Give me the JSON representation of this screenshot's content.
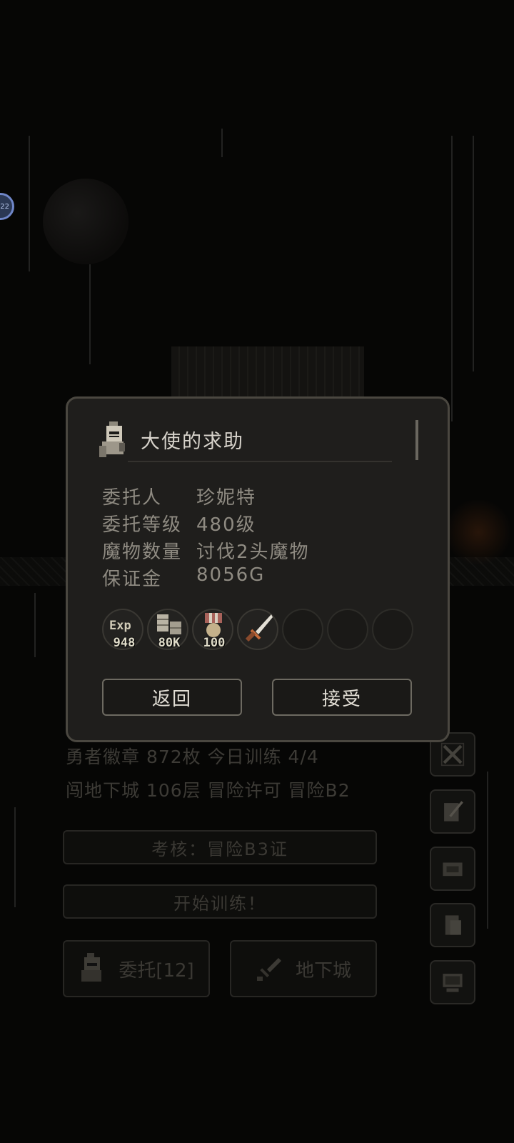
{
  "top_badge": "22",
  "dialog": {
    "title": "大使的求助",
    "details": [
      {
        "label": "委托人",
        "value": "珍妮特"
      },
      {
        "label": "委托等级",
        "value": "480级"
      },
      {
        "label": "魔物数量",
        "value": "讨伐2头魔物"
      },
      {
        "label": "保证金",
        "value": "8056G"
      }
    ],
    "rewards": [
      {
        "icon": "exp-icon",
        "icon_text": "Exp",
        "count": "948"
      },
      {
        "icon": "coins-icon",
        "count": "80K"
      },
      {
        "icon": "medal-icon",
        "count": "100"
      },
      {
        "icon": "sword-icon",
        "count": ""
      }
    ],
    "back_label": "返回",
    "accept_label": "接受"
  },
  "panel": {
    "line1": "勇者徽章 872枚  今日训练 4/4",
    "line2": "闯地下城 106层  冒险许可 冒险B2",
    "exam_label": "考核：冒险B3证",
    "train_label": "开始训练！",
    "commission_label": "委托[12]",
    "dungeon_label": "地下城"
  },
  "side_icons": [
    "crossed-swords-icon",
    "quill-scroll-icon",
    "map-scroll-icon",
    "book-icon",
    "computer-icon"
  ]
}
